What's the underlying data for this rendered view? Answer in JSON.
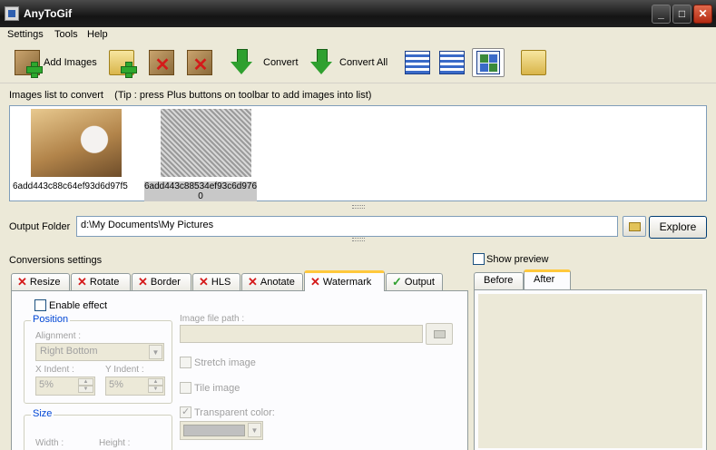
{
  "window": {
    "title": "AnyToGif"
  },
  "menu": [
    "Settings",
    "Tools",
    "Help"
  ],
  "toolbar": {
    "add_images": "Add Images",
    "convert": "Convert",
    "convert_all": "Convert All"
  },
  "images_list": {
    "label": "Images list to convert",
    "tip": "(Tip : press Plus buttons on toolbar to add images into list)",
    "items": [
      {
        "name": "6add443c88c64ef93d6d97f5",
        "selected": false
      },
      {
        "name_line1": "6add443c88534ef93c6d976",
        "name_line2": "0",
        "selected": true
      }
    ]
  },
  "output": {
    "label": "Output Folder",
    "path": "d:\\My Documents\\My Pictures",
    "explore": "Explore"
  },
  "conversion": {
    "label": "Conversions settings",
    "tabs": [
      "Resize",
      "Rotate",
      "Border",
      "HLS",
      "Anotate",
      "Watermark",
      "Output"
    ],
    "active_tab": "Watermark",
    "watermark": {
      "enable_effect": "Enable effect",
      "position_legend": "Position",
      "alignment_label": "Alignment :",
      "alignment_value": "Right Bottom",
      "x_indent_label": "X Indent :",
      "x_indent_value": "5%",
      "y_indent_label": "Y Indent :",
      "y_indent_value": "5%",
      "size_legend": "Size",
      "width_label": "Width :",
      "height_label": "Height :",
      "image_path_label": "Image file path :",
      "stretch_image": "Stretch image",
      "tile_image": "Tile image",
      "transparent_color": "Transparent color:"
    }
  },
  "preview": {
    "show_preview": "Show preview",
    "tabs": [
      "Before",
      "After"
    ],
    "active_tab": "After"
  }
}
